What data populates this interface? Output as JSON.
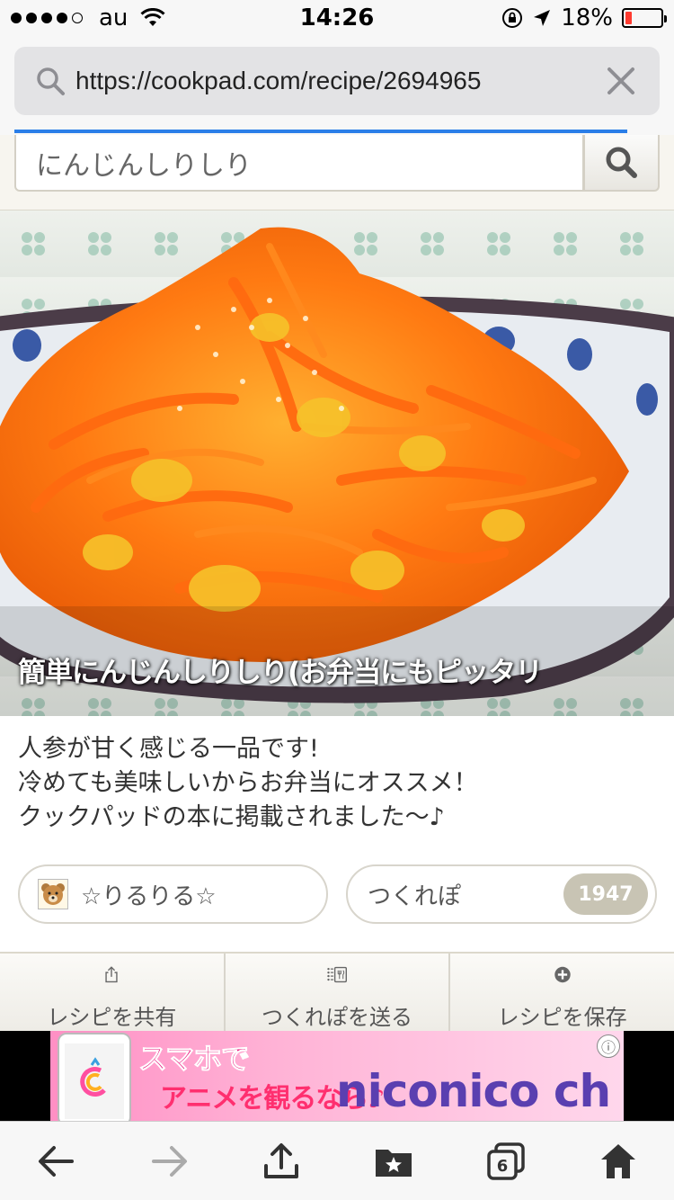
{
  "status_bar": {
    "carrier": "au",
    "time": "14:26",
    "battery_percent": "18%",
    "battery_level": 0.18,
    "signal_bars": 4
  },
  "browser": {
    "url": "https://cookpad.com/recipe/2694965",
    "load_progress": 0.95
  },
  "site_search": {
    "query": "にんじんしりしり"
  },
  "recipe": {
    "title": "簡単にんじんしりしり(お弁当にもピッタリ",
    "description": [
      "人参が甘く感じる一品です!",
      "冷めても美味しいからお弁当にオススメ！",
      "クックパッドの本に掲載されました〜♪"
    ],
    "author": "☆りるりる☆",
    "tsukurepo_label": "つくれぽ",
    "tsukurepo_count": "1947"
  },
  "actions": [
    {
      "label": "レシピを共有",
      "icon": "share-icon"
    },
    {
      "label": "つくれぽを送る",
      "icon": "tsukurepo-icon"
    },
    {
      "label": "レシピを保存",
      "icon": "add-circle-icon"
    }
  ],
  "ad": {
    "copy_line_1": "スマホで",
    "copy_line_2": "アニメを観るなら♪",
    "brand": "niconico ch"
  },
  "colors": {
    "accent": "#2a7ee8",
    "badge": "#c8c4b4",
    "carrot": "#ff6a10"
  }
}
